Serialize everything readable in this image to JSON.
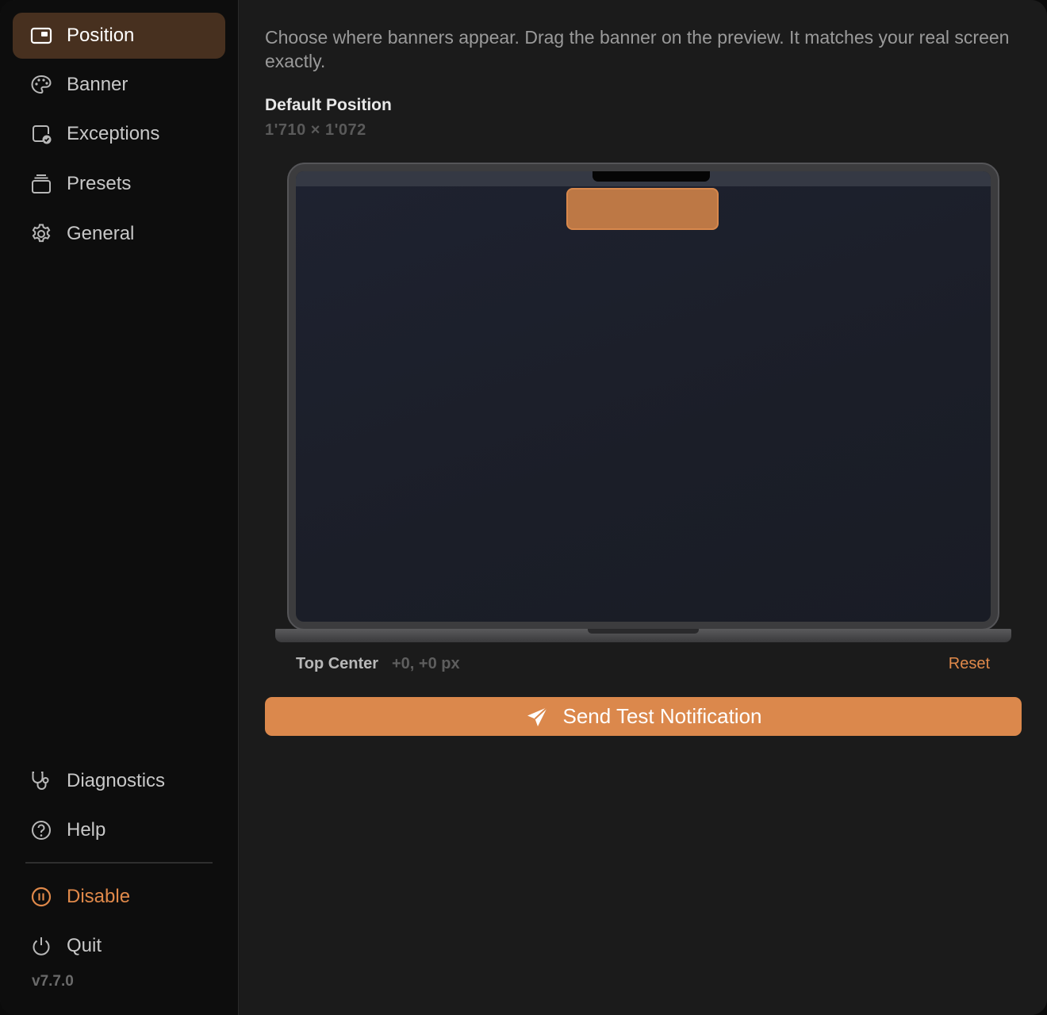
{
  "sidebar": {
    "top_items": [
      {
        "label": "Position",
        "icon": "window-position-icon",
        "active": true
      },
      {
        "label": "Banner",
        "icon": "palette-icon"
      },
      {
        "label": "Exceptions",
        "icon": "app-check-icon"
      },
      {
        "label": "Presets",
        "icon": "stack-icon"
      },
      {
        "label": "General",
        "icon": "gear-icon"
      }
    ],
    "bottom_items": [
      {
        "label": "Diagnostics",
        "icon": "stethoscope-icon"
      },
      {
        "label": "Help",
        "icon": "question-circle-icon"
      }
    ],
    "actions": [
      {
        "label": "Disable",
        "icon": "pause-circle-icon"
      },
      {
        "label": "Quit",
        "icon": "power-icon"
      }
    ],
    "version": "v7.7.0"
  },
  "main": {
    "description": "Choose where banners appear. Drag the banner on the preview. It matches your real screen exactly.",
    "section_title": "Default Position",
    "resolution": "1'710 × 1'072",
    "position_name": "Top Center",
    "position_offset": "+0, +0 px",
    "reset_label": "Reset",
    "send_button_label": "Send Test Notification",
    "send_button_icon": "paper-plane-icon"
  },
  "colors": {
    "accent": "#db884c",
    "active_nav_bg": "#47301f",
    "sidebar_bg": "#0d0d0d",
    "main_bg": "#1b1b1b"
  }
}
